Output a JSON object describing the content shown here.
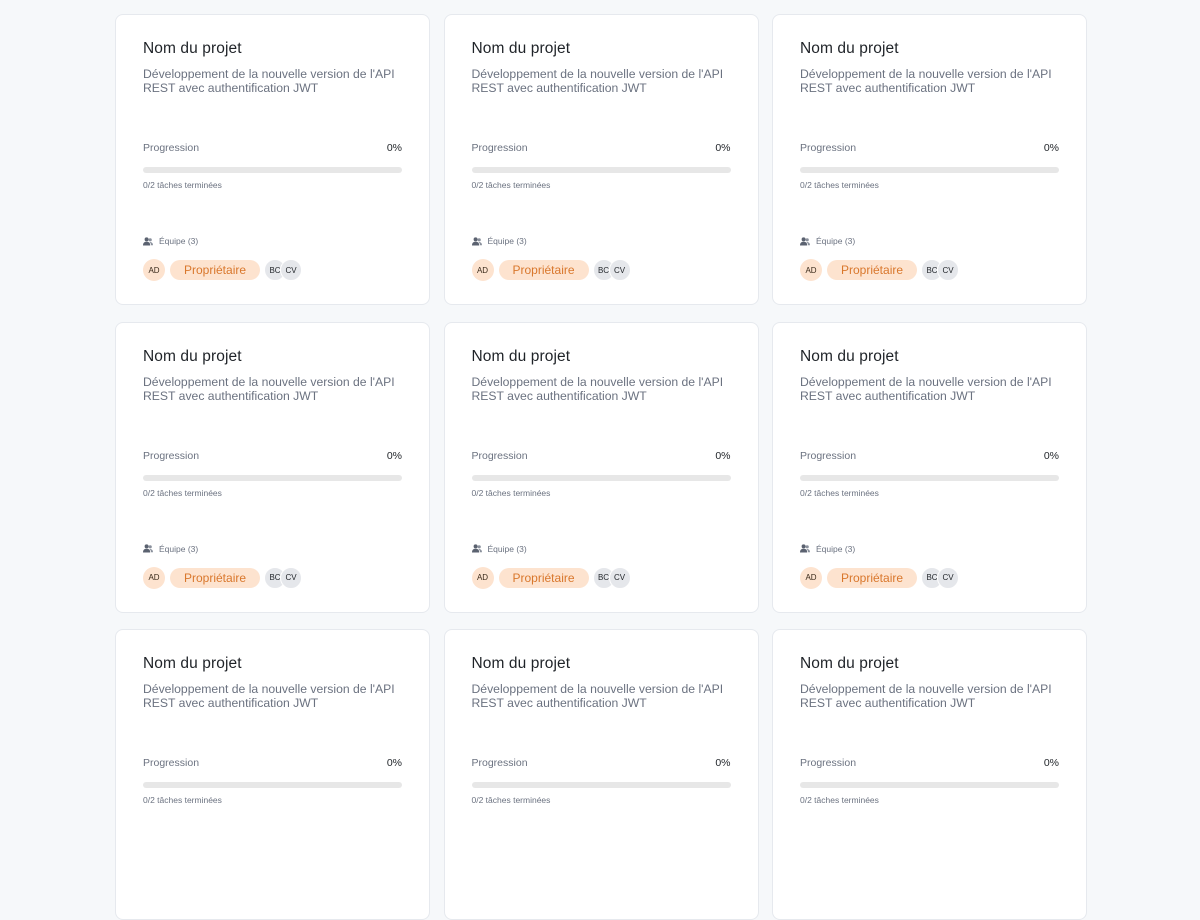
{
  "projects": [
    {
      "title": "Nom du projet",
      "description": "Développement de la nouvelle version de l'API REST avec authentification JWT",
      "progress_label": "Progression",
      "progress_percent": "0%",
      "progress_value": 0,
      "tasks_text": "0/2 tâches terminées",
      "team_label": "Équipe (3)",
      "owner_initials": "AD",
      "owner_label": "Propriétaire",
      "members": [
        "BC",
        "CV"
      ]
    },
    {
      "title": "Nom du projet",
      "description": "Développement de la nouvelle version de l'API REST avec authentification JWT",
      "progress_label": "Progression",
      "progress_percent": "0%",
      "progress_value": 0,
      "tasks_text": "0/2 tâches terminées",
      "team_label": "Équipe (3)",
      "owner_initials": "AD",
      "owner_label": "Propriétaire",
      "members": [
        "BC",
        "CV"
      ]
    },
    {
      "title": "Nom du projet",
      "description": "Développement de la nouvelle version de l'API REST avec authentification JWT",
      "progress_label": "Progression",
      "progress_percent": "0%",
      "progress_value": 0,
      "tasks_text": "0/2 tâches terminées",
      "team_label": "Équipe (3)",
      "owner_initials": "AD",
      "owner_label": "Propriétaire",
      "members": [
        "BC",
        "CV"
      ]
    },
    {
      "title": "Nom du projet",
      "description": "Développement de la nouvelle version de l'API REST avec authentification JWT",
      "progress_label": "Progression",
      "progress_percent": "0%",
      "progress_value": 0,
      "tasks_text": "0/2 tâches terminées",
      "team_label": "Équipe (3)",
      "owner_initials": "AD",
      "owner_label": "Propriétaire",
      "members": [
        "BC",
        "CV"
      ]
    },
    {
      "title": "Nom du projet",
      "description": "Développement de la nouvelle version de l'API REST avec authentification JWT",
      "progress_label": "Progression",
      "progress_percent": "0%",
      "progress_value": 0,
      "tasks_text": "0/2 tâches terminées",
      "team_label": "Équipe (3)",
      "owner_initials": "AD",
      "owner_label": "Propriétaire",
      "members": [
        "BC",
        "CV"
      ]
    },
    {
      "title": "Nom du projet",
      "description": "Développement de la nouvelle version de l'API REST avec authentification JWT",
      "progress_label": "Progression",
      "progress_percent": "0%",
      "progress_value": 0,
      "tasks_text": "0/2 tâches terminées",
      "team_label": "Équipe (3)",
      "owner_initials": "AD",
      "owner_label": "Propriétaire",
      "members": [
        "BC",
        "CV"
      ]
    },
    {
      "title": "Nom du projet",
      "description": "Développement de la nouvelle version de l'API REST avec authentification JWT",
      "progress_label": "Progression",
      "progress_percent": "0%",
      "progress_value": 0,
      "tasks_text": "0/2 tâches terminées"
    },
    {
      "title": "Nom du projet",
      "description": "Développement de la nouvelle version de l'API REST avec authentification JWT",
      "progress_label": "Progression",
      "progress_percent": "0%",
      "progress_value": 0,
      "tasks_text": "0/2 tâches terminées"
    },
    {
      "title": "Nom du projet",
      "description": "Développement de la nouvelle version de l'API REST avec authentification JWT",
      "progress_label": "Progression",
      "progress_percent": "0%",
      "progress_value": 0,
      "tasks_text": "0/2 tâches terminées"
    }
  ],
  "colors": {
    "accent": "#f19a53",
    "owner_badge_bg": "#fde3cf",
    "owner_badge_text": "#d9772c",
    "page_bg": "#f6f8fa"
  },
  "icons": {
    "team": "users-icon"
  }
}
